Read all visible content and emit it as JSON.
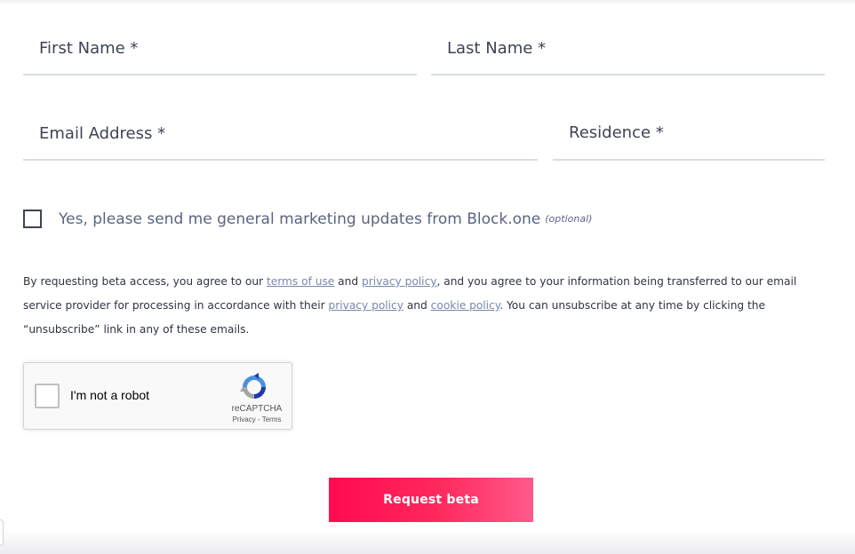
{
  "form": {
    "first_name_placeholder": "First Name *",
    "last_name_placeholder": "Last Name *",
    "email_placeholder": "Email Address *",
    "residence_value": "Residence *"
  },
  "marketing": {
    "label": "Yes, please send me general marketing updates from Block.one",
    "optional": "(optional)",
    "checked": false
  },
  "legal": {
    "t1": "By requesting beta access, you agree to our ",
    "terms_link": "terms of use",
    "t2": " and ",
    "privacy_link_1": "privacy policy",
    "t3": ", and you agree to your information being transferred to our email service provider for processing in accordance with their ",
    "privacy_link_2": "privacy policy",
    "t4": " and ",
    "cookie_link": "cookie policy",
    "t5": ". You can unsubscribe at any time by clicking the “unsubscribe” link in any of these emails."
  },
  "recaptcha": {
    "label": "I'm not a robot",
    "brand": "reCAPTCHA",
    "privacy": "Privacy",
    "separator": " - ",
    "terms": "Terms",
    "icon": "recaptcha-logo-icon",
    "checked": false
  },
  "submit": {
    "label": "Request beta",
    "color_start": "#ff0a4f",
    "color_end": "#ff5a8a"
  }
}
